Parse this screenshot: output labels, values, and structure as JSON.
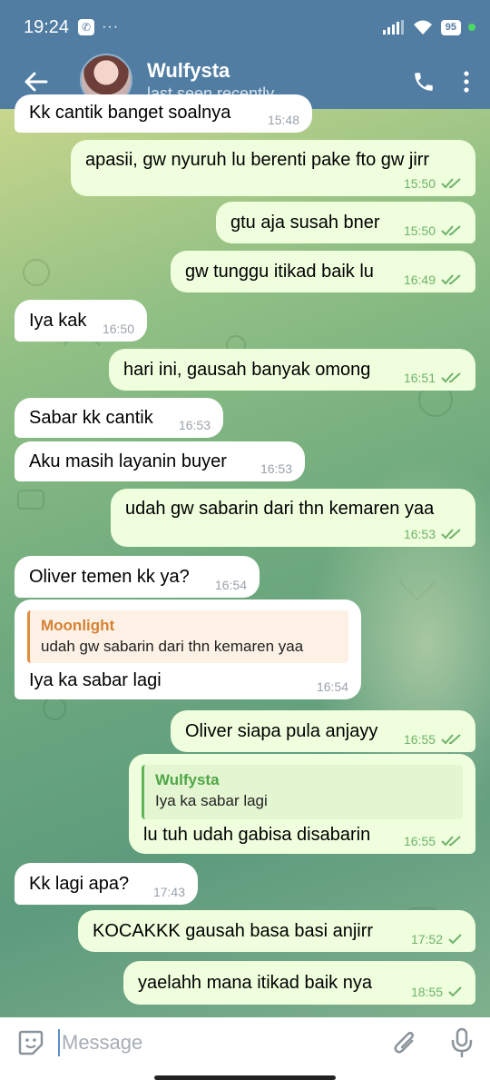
{
  "status_bar": {
    "time": "19:24",
    "dots": "···",
    "battery": "95"
  },
  "header": {
    "name": "Wulfysta",
    "status": "last seen recently"
  },
  "messages": [
    {
      "dir": "in",
      "text": "Kk cantik banget soalnya",
      "time": "15:48",
      "read": false
    },
    {
      "dir": "out",
      "text": "apasii, gw nyuruh lu berenti pake fto gw jirr",
      "time": "15:50",
      "read": true
    },
    {
      "dir": "out",
      "text": "gtu aja susah bner",
      "time": "15:50",
      "read": true
    },
    {
      "dir": "out",
      "text": "gw tunggu itikad baik lu",
      "time": "16:49",
      "read": true
    },
    {
      "dir": "in",
      "text": "Iya kak",
      "time": "16:50",
      "read": false
    },
    {
      "dir": "out",
      "text": "hari ini, gausah banyak omong",
      "time": "16:51",
      "read": true
    },
    {
      "dir": "in",
      "text": "Sabar kk cantik",
      "time": "16:53",
      "read": false
    },
    {
      "dir": "in",
      "text": "Aku masih layanin buyer",
      "time": "16:53",
      "read": false
    },
    {
      "dir": "out",
      "text": "udah gw sabarin dari thn kemaren yaa",
      "time": "16:53",
      "read": true
    },
    {
      "dir": "in",
      "text": "Oliver temen kk ya?",
      "time": "16:54",
      "read": false
    },
    {
      "dir": "in",
      "text": "Iya ka sabar lagi",
      "time": "16:54",
      "read": false,
      "reply": {
        "name": "Moonlight",
        "text": "udah gw sabarin dari thn kemaren yaa"
      }
    },
    {
      "dir": "out",
      "text": "Oliver siapa pula anjayy",
      "time": "16:55",
      "read": true
    },
    {
      "dir": "out",
      "text": "lu tuh udah gabisa disabarin",
      "time": "16:55",
      "read": true,
      "reply": {
        "name": "Wulfysta",
        "text": "Iya ka sabar lagi"
      }
    },
    {
      "dir": "in",
      "text": "Kk lagi apa?",
      "time": "17:43",
      "read": false
    },
    {
      "dir": "out",
      "text": "KOCAKKK gausah basa basi anjirr",
      "time": "17:52",
      "read": false
    },
    {
      "dir": "out",
      "text": "yaelahh mana itikad baik nya",
      "time": "18:55",
      "read": false
    }
  ],
  "input": {
    "placeholder": "Message"
  },
  "colors": {
    "header": "#517da2",
    "outgoing_bubble": "#effedd",
    "incoming_bubble": "#ffffff",
    "read_check": "#6fb26a"
  },
  "icons": [
    "whatsapp-icon",
    "signal-icon",
    "wifi-icon",
    "battery-icon",
    "back-arrow-icon",
    "phone-icon",
    "more-vertical-icon",
    "sticker-icon",
    "attach-icon",
    "mic-icon"
  ]
}
